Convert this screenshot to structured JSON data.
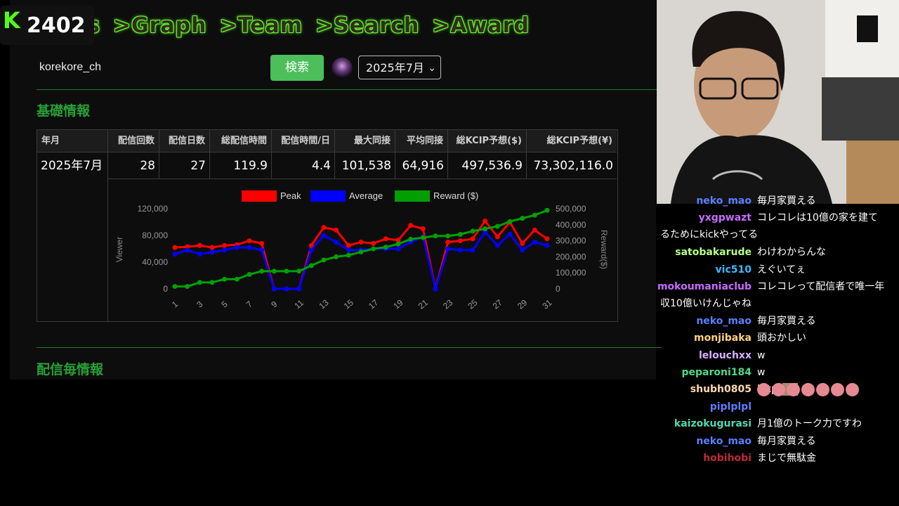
{
  "nav": {
    "items": [
      ">Graph",
      ">Team",
      ">Search",
      ">Award"
    ],
    "partial": "s"
  },
  "stream": {
    "viewer_count": "2402",
    "logo": "kick-logo"
  },
  "search": {
    "query": "korekore_ch",
    "button": "検索",
    "month": "2025年7月"
  },
  "sections": {
    "basic": "基礎情報",
    "per_stream": "配信毎情報"
  },
  "table": {
    "headers": [
      "年月",
      "配信回数",
      "配信日数",
      "総配信時間",
      "配信時間/日",
      "最大同接",
      "平均同接",
      "総KCIP予想($)",
      "総KCIP予想(¥)"
    ],
    "row": [
      "2025年7月",
      "28",
      "27",
      "119.9",
      "4.4",
      "101,538",
      "64,916",
      "497,536.9",
      "73,302,116.0"
    ]
  },
  "chart_data": {
    "type": "line",
    "x": [
      1,
      2,
      3,
      4,
      5,
      6,
      7,
      8,
      9,
      10,
      11,
      12,
      13,
      14,
      15,
      16,
      17,
      18,
      19,
      20,
      21,
      22,
      23,
      24,
      25,
      26,
      27,
      28,
      29,
      30,
      31
    ],
    "x_ticks": [
      "1",
      "3",
      "5",
      "7",
      "9",
      "11",
      "13",
      "15",
      "17",
      "19",
      "21",
      "23",
      "25",
      "27",
      "29",
      "31"
    ],
    "y_left": {
      "label": "Viewer",
      "ticks": [
        "0",
        "40,000",
        "80,000",
        "120,000"
      ],
      "range": [
        0,
        120000
      ]
    },
    "y_right": {
      "label": "Reward($)",
      "ticks": [
        "0",
        "100,000",
        "200,000",
        "300,000",
        "400,000",
        "500,000"
      ],
      "range": [
        0,
        500000
      ]
    },
    "legend": "top",
    "series": [
      {
        "name": "Peak",
        "axis": "left",
        "color": "#ff0000",
        "values": [
          62000,
          63000,
          65000,
          62000,
          65000,
          66000,
          72000,
          68000,
          0,
          0,
          0,
          65000,
          92000,
          88000,
          65000,
          70000,
          68000,
          75000,
          73000,
          95000,
          90000,
          0,
          70000,
          72000,
          75000,
          101538,
          78000,
          100000,
          68000,
          88000,
          75000
        ]
      },
      {
        "name": "Average",
        "axis": "left",
        "color": "#0000ff",
        "values": [
          52000,
          58000,
          52000,
          55000,
          58000,
          62000,
          62000,
          58000,
          0,
          0,
          0,
          58000,
          80000,
          70000,
          58000,
          58000,
          60000,
          60000,
          60000,
          70000,
          78000,
          0,
          60000,
          58000,
          58000,
          85000,
          65000,
          82000,
          58000,
          70000,
          65000
        ]
      },
      {
        "name": "Reward ($)",
        "axis": "right",
        "color": "#00a000",
        "values": [
          15000,
          15000,
          40000,
          40000,
          60000,
          60000,
          90000,
          110000,
          110000,
          110000,
          110000,
          145000,
          180000,
          200000,
          210000,
          230000,
          250000,
          260000,
          280000,
          310000,
          320000,
          330000,
          330000,
          340000,
          360000,
          375000,
          390000,
          420000,
          440000,
          460000,
          490000
        ]
      }
    ]
  },
  "chat": [
    {
      "user": "neko_mao",
      "color": "#5b7fff",
      "lines": [
        "毎月家買える"
      ]
    },
    {
      "user": "yxgpwazt",
      "color": "#c86bff",
      "lines": [
        "コレコレは10億の家を建て",
        "るためにkickやってる"
      ]
    },
    {
      "user": "satobakarude",
      "color": "#b8ff8a",
      "lines": [
        "わけわからんな"
      ]
    },
    {
      "user": "vic510",
      "color": "#3fb9ff",
      "lines": [
        "えぐいてぇ"
      ]
    },
    {
      "user": "mokoumaniaclub",
      "color": "#c86bff",
      "lines": [
        "コレコレって配信者で唯一年",
        "収10億いけんじゃね"
      ]
    },
    {
      "user": "neko_mao",
      "color": "#5b7fff",
      "lines": [
        "毎月家買える"
      ]
    },
    {
      "user": "monjibaka",
      "color": "#ffd27f",
      "lines": [
        "頭おかしい"
      ]
    },
    {
      "user": "lelouchxx",
      "color": "#d8b0ff",
      "lines": [
        "w"
      ]
    },
    {
      "user": "peparoni184",
      "color": "#4fd98a",
      "lines": [
        "w"
      ]
    },
    {
      "user": "shubh0805",
      "color": "#ffd9b0",
      "lines": [
        "https"
      ]
    },
    {
      "user": "piplplpl",
      "color": "#5b7fff",
      "lines": [
        ""
      ]
    },
    {
      "user": "kaizokugurasi",
      "color": "#4fd9b0",
      "lines": [
        "月1億のトーク力ですわ"
      ]
    },
    {
      "user": "neko_mao",
      "color": "#5b7fff",
      "lines": [
        "毎月家買える"
      ]
    },
    {
      "user": "hobihobi",
      "color": "#c0283a",
      "lines": [
        "まじで無駄金"
      ]
    }
  ]
}
